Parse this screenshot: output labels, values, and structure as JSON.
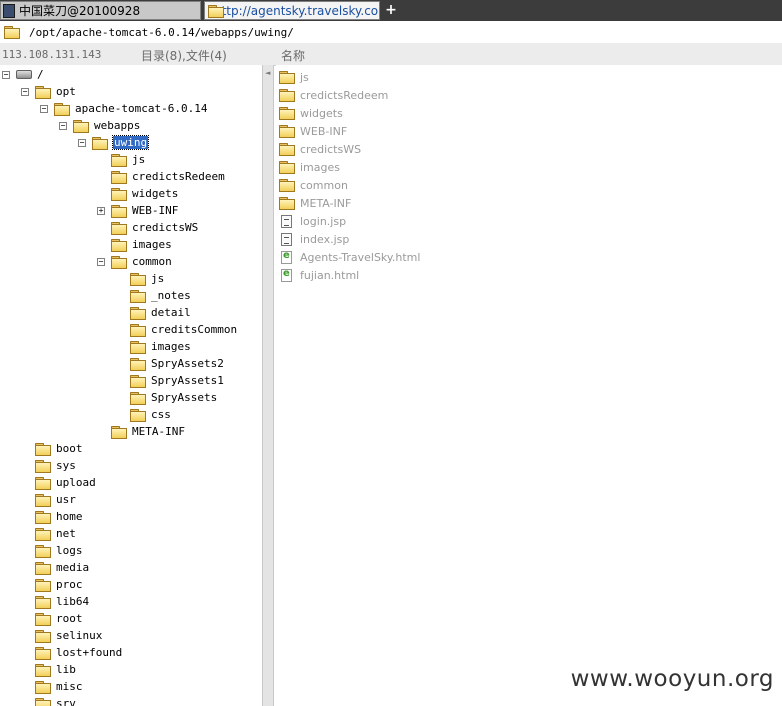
{
  "tabs": [
    {
      "label": "中国菜刀@20100928",
      "active": false
    },
    {
      "label": "http://agentsky.travelsky.com...",
      "active": true
    }
  ],
  "new_tab_label": "+",
  "address": {
    "path": "/opt/apache-tomcat-6.0.14/webapps/uwing/"
  },
  "header": {
    "ip": "113.108.131.143",
    "counts": "目录(8),文件(4)",
    "name_column": "名称"
  },
  "tree": {
    "root": {
      "label": "/",
      "icon": "drive-icon",
      "toggle": "−"
    },
    "nodes": [
      {
        "label": "opt",
        "toggle": "−"
      },
      {
        "label": "apache-tomcat-6.0.14",
        "toggle": "−"
      },
      {
        "label": "webapps",
        "toggle": "−"
      },
      {
        "label": "uwing",
        "toggle": "−",
        "selected": true
      },
      {
        "label": "js"
      },
      {
        "label": "credictsRedeem"
      },
      {
        "label": "widgets"
      },
      {
        "label": "WEB-INF",
        "toggle": "+"
      },
      {
        "label": "credictsWS"
      },
      {
        "label": "images"
      },
      {
        "label": "common",
        "toggle": "−"
      },
      {
        "label": "js"
      },
      {
        "label": "_notes"
      },
      {
        "label": "detail"
      },
      {
        "label": "creditsCommon"
      },
      {
        "label": "images"
      },
      {
        "label": "SpryAssets2"
      },
      {
        "label": "SpryAssets1"
      },
      {
        "label": "SpryAssets"
      },
      {
        "label": "css"
      },
      {
        "label": "META-INF"
      },
      {
        "label": "boot"
      },
      {
        "label": "sys"
      },
      {
        "label": "upload"
      },
      {
        "label": "usr"
      },
      {
        "label": "home"
      },
      {
        "label": "net"
      },
      {
        "label": "logs"
      },
      {
        "label": "media"
      },
      {
        "label": "proc"
      },
      {
        "label": "lib64"
      },
      {
        "label": "root"
      },
      {
        "label": "selinux"
      },
      {
        "label": "lost+found"
      },
      {
        "label": "lib"
      },
      {
        "label": "misc"
      },
      {
        "label": "srv"
      }
    ]
  },
  "files": [
    {
      "name": "js",
      "type": "folder"
    },
    {
      "name": "credictsRedeem",
      "type": "folder"
    },
    {
      "name": "widgets",
      "type": "folder"
    },
    {
      "name": "WEB-INF",
      "type": "folder"
    },
    {
      "name": "credictsWS",
      "type": "folder"
    },
    {
      "name": "images",
      "type": "folder"
    },
    {
      "name": "common",
      "type": "folder"
    },
    {
      "name": "META-INF",
      "type": "folder"
    },
    {
      "name": "login.jsp",
      "type": "file"
    },
    {
      "name": "index.jsp",
      "type": "file"
    },
    {
      "name": "Agents-TravelSky.html",
      "type": "html"
    },
    {
      "name": "fujian.html",
      "type": "html"
    }
  ],
  "splitter_arrow": "◄",
  "watermark": "www.wooyun.org",
  "colors": {
    "selection": "#316ac5",
    "tabbar": "#3c3c3c",
    "muted_text": "#9a9a9a"
  }
}
